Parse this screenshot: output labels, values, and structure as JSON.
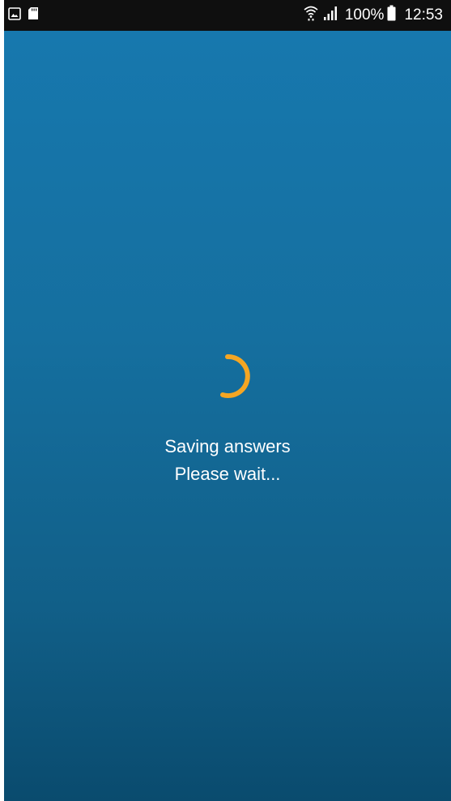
{
  "status_bar": {
    "left_icons": [
      "gallery-notification-icon",
      "sd-card-icon"
    ],
    "right_icons": [
      "wifi-icon",
      "signal-icon",
      "battery-icon"
    ],
    "battery_percent": "100%",
    "time": "12:53"
  },
  "loading": {
    "spinner_icon": "loading-spinner-icon",
    "spinner_color": "#f5a623",
    "line1": "Saving answers",
    "line2": "Please wait..."
  },
  "colors": {
    "status_bar_bg": "#0f0f0f",
    "background_top": "#1778ae",
    "background_bottom": "#0a4b6e",
    "text": "#ffffff"
  }
}
